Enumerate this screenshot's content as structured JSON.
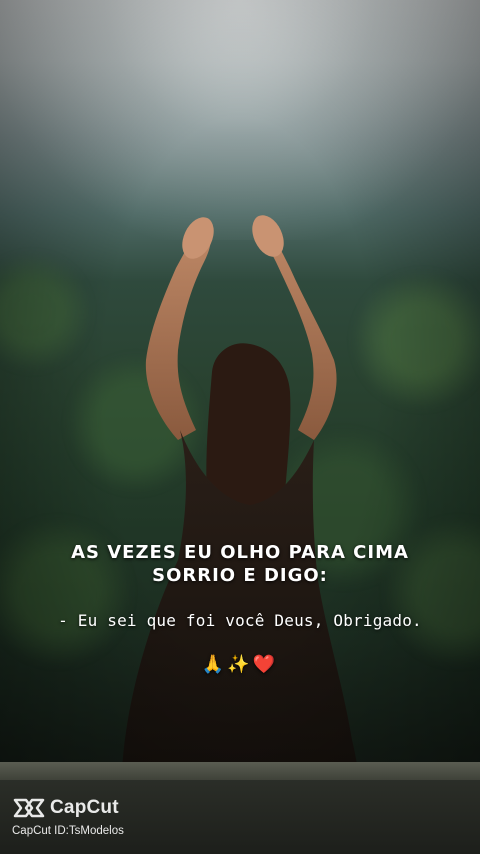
{
  "overlay": {
    "headline_line1": "AS VEZES EU OLHO PARA CIMA",
    "headline_line2": "SORRIO E DIGO:",
    "quote": "- Eu sei que foi você Deus, Obrigado.",
    "emojis": "🙏✨❤️"
  },
  "watermark": {
    "brand": "CapCut",
    "brand_icon": "capcut-logo-icon",
    "template_id": "CapCut ID:TsModelos"
  }
}
